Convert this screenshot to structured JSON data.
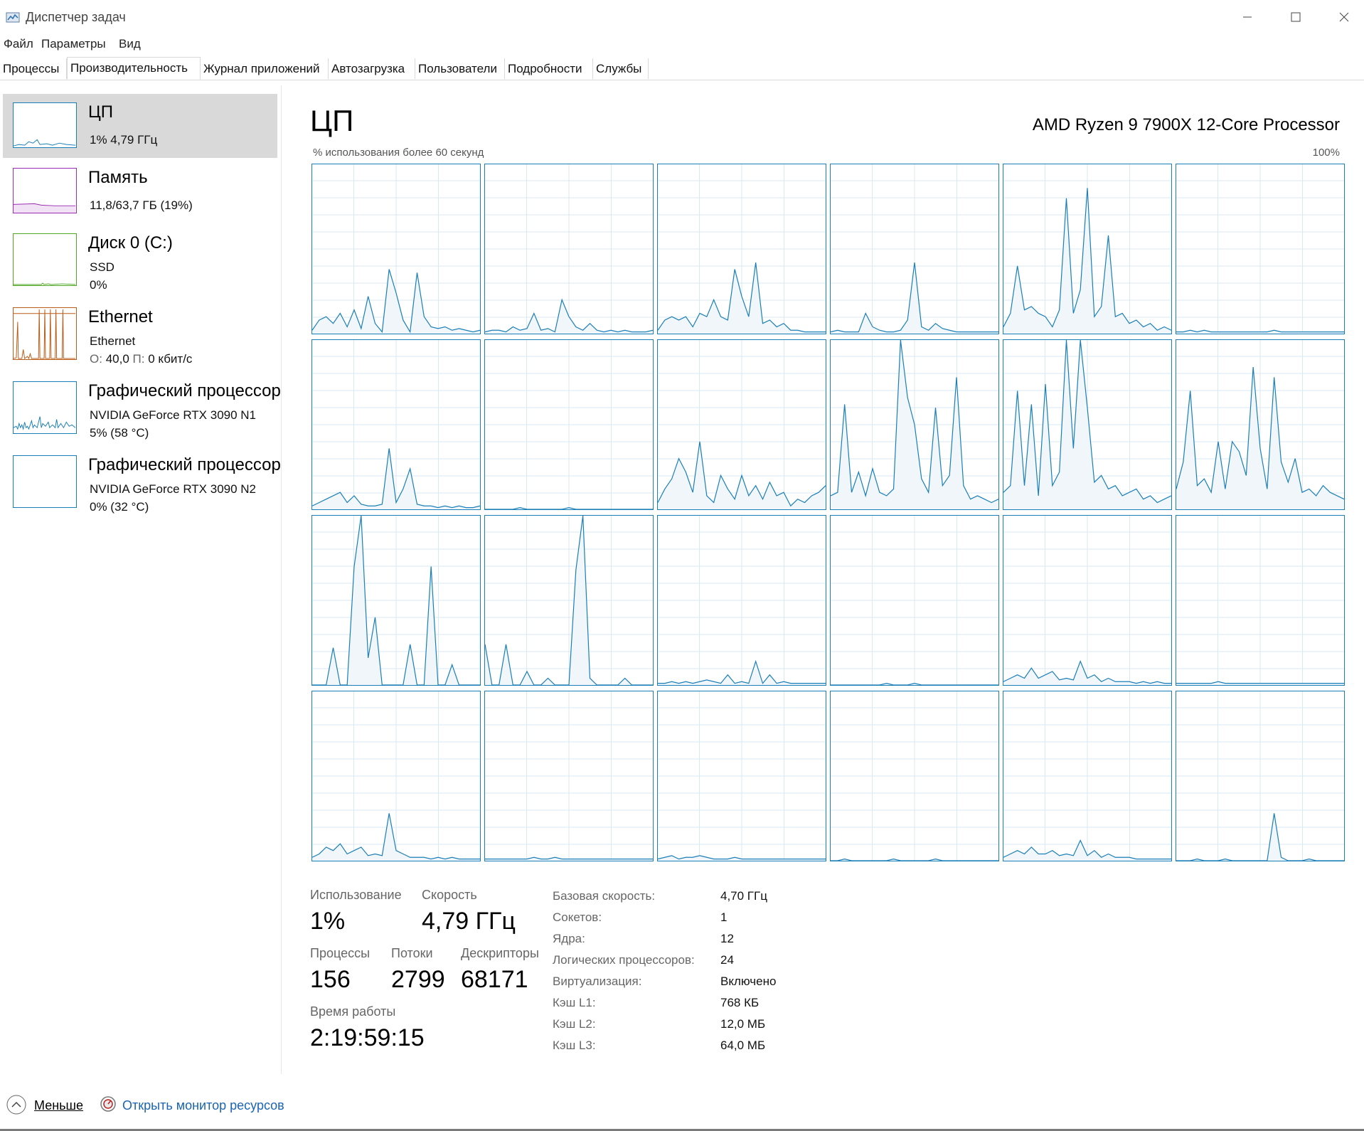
{
  "window": {
    "title": "Диспетчер задач"
  },
  "menu": {
    "file": "Файл",
    "options": "Параметры",
    "view": "Вид"
  },
  "tabs": [
    "Процессы",
    "Производительность",
    "Журнал приложений",
    "Автозагрузка",
    "Пользователи",
    "Подробности",
    "Службы"
  ],
  "sidebar": {
    "cpu": {
      "name": "ЦП",
      "line1": "1%  4,79 ГГц"
    },
    "memory": {
      "name": "Память",
      "line1": "11,8/63,7 ГБ (19%)"
    },
    "disk": {
      "name": "Диск 0 (C:)",
      "line1": "SSD",
      "line2": "0%"
    },
    "ethernet": {
      "name": "Ethernet",
      "line1": "Ethernet",
      "line2_o": "О:",
      "line2_o_val": "40,0",
      "line2_p": "П:",
      "line2_p_val": "0 кбит/с"
    },
    "gpu1": {
      "name": "Графический процессор",
      "line1": "NVIDIA GeForce RTX 3090 N1",
      "line2": "5%  (58 °C)"
    },
    "gpu2": {
      "name": "Графический процессор",
      "line1": "NVIDIA GeForce RTX 3090 N2",
      "line2": "0%  (32 °C)"
    }
  },
  "main": {
    "title": "ЦП",
    "cpu_model": "AMD Ryzen 9 7900X 12-Core Processor",
    "graph_label": "% использования более 60 секунд",
    "graph_max": "100%"
  },
  "stats": {
    "usage_label": "Использование",
    "usage": "1%",
    "speed_label": "Скорость",
    "speed": "4,79 ГГц",
    "processes_label": "Процессы",
    "processes": "156",
    "threads_label": "Потоки",
    "threads": "2799",
    "handles_label": "Дескрипторы",
    "handles": "68171",
    "uptime_label": "Время работы",
    "uptime": "2:19:59:15"
  },
  "specs": [
    {
      "label": "Базовая скорость:",
      "value": "4,70 ГГц"
    },
    {
      "label": "Сокетов:",
      "value": "1"
    },
    {
      "label": "Ядра:",
      "value": "12"
    },
    {
      "label": "Логических процессоров:",
      "value": "24"
    },
    {
      "label": "Виртуализация:",
      "value": "Включено"
    },
    {
      "label": "Кэш L1:",
      "value": "768 КБ"
    },
    {
      "label": "Кэш L2:",
      "value": "12,0 МБ"
    },
    {
      "label": "Кэш L3:",
      "value": "64,0 МБ"
    }
  ],
  "footer": {
    "less": "Меньше",
    "resmon": "Открыть монитор ресурсов"
  },
  "colors": {
    "cpu": "#1a7fb8",
    "memory": "#9b2db4",
    "disk": "#4da624",
    "ethernet": "#b85c1a",
    "gpu": "#1a7fb8",
    "selected": "#d9d9d9"
  },
  "chart_data": {
    "type": "line",
    "title": "% использования более 60 секунд",
    "ylim": [
      0,
      100
    ],
    "series": [
      {
        "values": [
          2,
          8,
          10,
          6,
          12,
          4,
          14,
          3,
          22,
          6,
          1,
          38,
          24,
          8,
          1,
          36,
          10,
          4,
          3,
          4,
          2,
          3,
          2,
          1,
          2
        ]
      },
      {
        "values": [
          1,
          2,
          2,
          1,
          4,
          2,
          3,
          12,
          2,
          3,
          1,
          20,
          10,
          4,
          2,
          6,
          2,
          1,
          2,
          1,
          2,
          1,
          1,
          1,
          2
        ]
      },
      {
        "values": [
          2,
          8,
          10,
          8,
          10,
          4,
          12,
          10,
          20,
          10,
          8,
          38,
          22,
          10,
          42,
          6,
          8,
          4,
          6,
          2,
          2,
          1,
          1,
          1,
          1
        ]
      },
      {
        "values": [
          1,
          2,
          1,
          1,
          1,
          12,
          4,
          2,
          1,
          1,
          2,
          8,
          42,
          4,
          2,
          6,
          3,
          2,
          1,
          1,
          1,
          1,
          1,
          1,
          1
        ]
      },
      {
        "values": [
          4,
          12,
          40,
          14,
          16,
          12,
          10,
          4,
          14,
          80,
          12,
          26,
          86,
          10,
          16,
          58,
          10,
          12,
          6,
          8,
          4,
          6,
          2,
          4,
          2
        ]
      },
      {
        "values": [
          1,
          1,
          2,
          1,
          2,
          1,
          1,
          1,
          1,
          1,
          1,
          1,
          1,
          1,
          2,
          1,
          1,
          1,
          1,
          1,
          1,
          1,
          1,
          1,
          1
        ]
      },
      {
        "values": [
          2,
          4,
          6,
          8,
          10,
          4,
          8,
          3,
          2,
          2,
          3,
          36,
          4,
          12,
          24,
          3,
          2,
          2,
          1,
          2,
          1,
          2,
          1,
          1,
          2
        ]
      },
      {
        "values": [
          0,
          0,
          0,
          0,
          0,
          1,
          0,
          0,
          0,
          0,
          0,
          0,
          1,
          0,
          0,
          0,
          0,
          0,
          0,
          0,
          0,
          0,
          0,
          0,
          0
        ]
      },
      {
        "values": [
          4,
          12,
          18,
          30,
          22,
          10,
          40,
          8,
          4,
          20,
          12,
          6,
          20,
          8,
          14,
          6,
          16,
          8,
          10,
          2,
          6,
          4,
          8,
          10,
          14
        ]
      },
      {
        "values": [
          8,
          10,
          62,
          10,
          22,
          8,
          24,
          10,
          8,
          12,
          100,
          66,
          50,
          18,
          10,
          60,
          14,
          20,
          78,
          14,
          6,
          8,
          6,
          4,
          6
        ]
      },
      {
        "values": [
          10,
          14,
          70,
          14,
          62,
          8,
          74,
          14,
          22,
          100,
          36,
          100,
          60,
          16,
          20,
          12,
          14,
          8,
          10,
          12,
          6,
          8,
          4,
          6,
          8
        ]
      },
      {
        "values": [
          12,
          28,
          70,
          14,
          18,
          10,
          40,
          12,
          40,
          34,
          20,
          84,
          36,
          12,
          78,
          28,
          16,
          30,
          10,
          12,
          8,
          14,
          10,
          8,
          6
        ]
      },
      {
        "values": [
          0,
          0,
          0,
          22,
          0,
          0,
          70,
          100,
          16,
          40,
          0,
          0,
          0,
          0,
          24,
          0,
          0,
          70,
          0,
          0,
          12,
          0,
          0,
          0,
          0
        ]
      },
      {
        "values": [
          24,
          0,
          0,
          24,
          0,
          0,
          8,
          0,
          0,
          4,
          0,
          0,
          0,
          68,
          100,
          4,
          0,
          0,
          0,
          0,
          4,
          0,
          0,
          0,
          0
        ]
      },
      {
        "values": [
          1,
          1,
          2,
          1,
          2,
          1,
          2,
          3,
          2,
          1,
          6,
          1,
          2,
          1,
          14,
          1,
          6,
          1,
          2,
          1,
          1,
          1,
          1,
          1,
          1
        ]
      },
      {
        "values": [
          0,
          0,
          0,
          0,
          0,
          0,
          0,
          0,
          1,
          0,
          0,
          0,
          1,
          0,
          0,
          0,
          0,
          0,
          0,
          0,
          0,
          0,
          0,
          0,
          0
        ]
      },
      {
        "values": [
          2,
          4,
          6,
          4,
          10,
          4,
          6,
          8,
          3,
          4,
          3,
          14,
          4,
          6,
          2,
          4,
          2,
          2,
          2,
          1,
          2,
          1,
          2,
          1,
          1
        ]
      },
      {
        "values": [
          1,
          1,
          1,
          1,
          1,
          1,
          2,
          1,
          1,
          1,
          1,
          1,
          1,
          1,
          1,
          1,
          1,
          1,
          1,
          1,
          1,
          1,
          1,
          1,
          1
        ]
      },
      {
        "values": [
          2,
          4,
          8,
          6,
          10,
          4,
          6,
          8,
          3,
          4,
          3,
          28,
          6,
          4,
          2,
          2,
          2,
          1,
          2,
          1,
          2,
          1,
          1,
          1,
          1
        ]
      },
      {
        "values": [
          1,
          1,
          1,
          1,
          1,
          1,
          1,
          2,
          1,
          1,
          2,
          1,
          1,
          1,
          1,
          1,
          1,
          1,
          1,
          1,
          1,
          1,
          1,
          1,
          1
        ]
      },
      {
        "values": [
          1,
          2,
          3,
          1,
          2,
          2,
          3,
          2,
          1,
          1,
          1,
          2,
          1,
          1,
          1,
          1,
          1,
          1,
          1,
          1,
          1,
          1,
          1,
          1,
          1
        ]
      },
      {
        "values": [
          0,
          0,
          1,
          0,
          0,
          0,
          0,
          0,
          0,
          1,
          0,
          0,
          0,
          0,
          0,
          1,
          0,
          0,
          0,
          0,
          0,
          0,
          0,
          0,
          0
        ]
      },
      {
        "values": [
          2,
          4,
          6,
          4,
          8,
          4,
          4,
          6,
          3,
          4,
          3,
          12,
          3,
          6,
          2,
          4,
          2,
          2,
          2,
          1,
          1,
          1,
          1,
          1,
          1
        ]
      },
      {
        "values": [
          0,
          0,
          0,
          1,
          0,
          0,
          0,
          1,
          0,
          0,
          0,
          0,
          0,
          0,
          28,
          2,
          0,
          0,
          0,
          1,
          0,
          0,
          0,
          0,
          0
        ]
      }
    ]
  }
}
